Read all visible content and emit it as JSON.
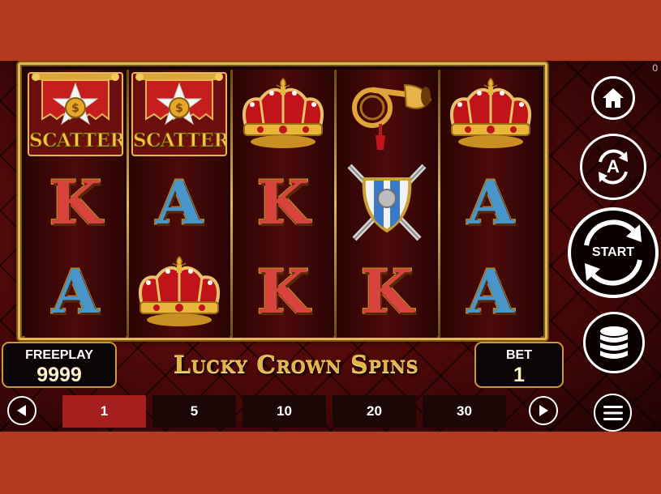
{
  "corner_counter": "0",
  "reels": [
    [
      "scatter",
      "k",
      "a"
    ],
    [
      "scatter",
      "a",
      "crown"
    ],
    [
      "crown",
      "k",
      "k"
    ],
    [
      "horn",
      "shield",
      "k"
    ],
    [
      "crown",
      "a",
      "a"
    ]
  ],
  "symbols": {
    "scatter_label": "SCATTER",
    "k_letter": "K",
    "a_letter": "A"
  },
  "freeplay": {
    "label": "FREEPLAY",
    "value": "9999"
  },
  "bet": {
    "label": "BET",
    "value": "1"
  },
  "logo_text": "Lucky Crown Spins",
  "bet_options": [
    "1",
    "5",
    "10",
    "20",
    "30"
  ],
  "selected_bet": "1",
  "side_buttons": {
    "start_label": "START",
    "auto_label": "A"
  },
  "colors": {
    "page_bg": "#b5391c",
    "gold": "#e6b655",
    "active_bet": "#a51f1f"
  }
}
